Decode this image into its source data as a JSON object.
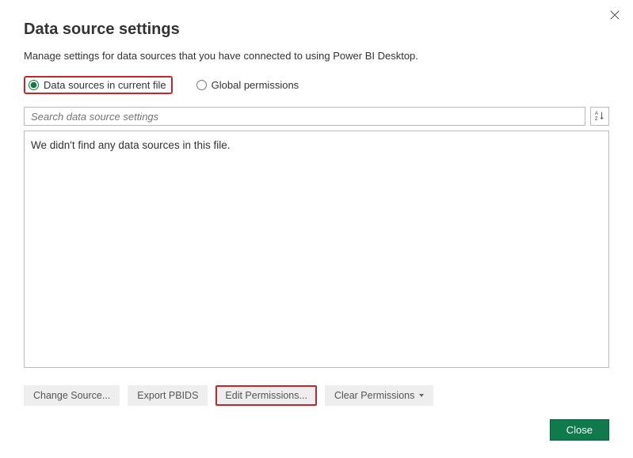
{
  "dialog": {
    "title": "Data source settings",
    "subtitle": "Manage settings for data sources that you have connected to using Power BI Desktop."
  },
  "scope": {
    "current_file_label": "Data sources in current file",
    "global_label": "Global permissions",
    "selected": "current_file"
  },
  "search": {
    "placeholder": "Search data source settings"
  },
  "list": {
    "empty_message": "We didn't find any data sources in this file."
  },
  "buttons": {
    "change_source": "Change Source...",
    "export_pbids": "Export PBIDS",
    "edit_permissions": "Edit Permissions...",
    "clear_permissions": "Clear Permissions",
    "close": "Close"
  }
}
